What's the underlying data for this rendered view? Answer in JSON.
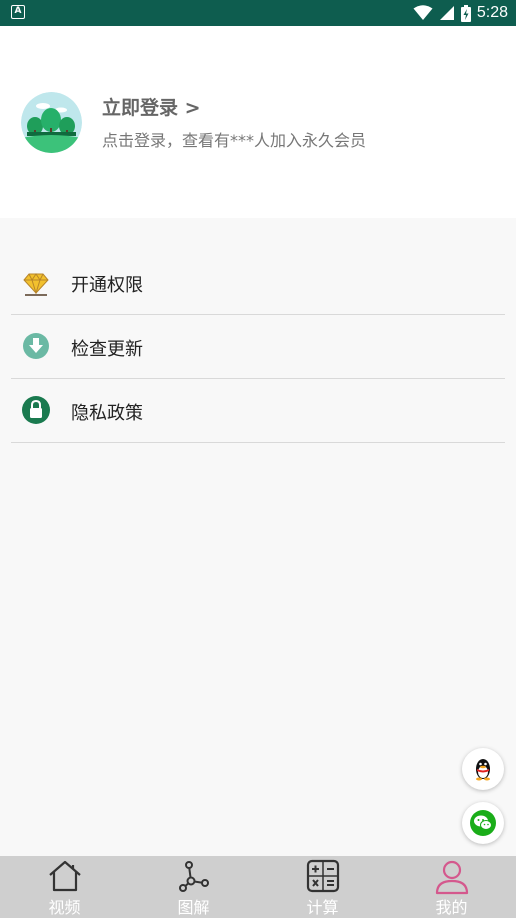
{
  "status_bar": {
    "app_badge": "A",
    "time": "5:28",
    "icons": [
      "wifi-icon",
      "signal-icon",
      "battery-charging-icon"
    ]
  },
  "profile": {
    "avatar_icon": "forest-avatar-icon",
    "login_title": "立即登录 >",
    "login_subtitle": "点击登录，查看有***人加入永久会员"
  },
  "menu": {
    "items": [
      {
        "label": "开通权限",
        "icon": "diamond-icon"
      },
      {
        "label": "检查更新",
        "icon": "download-circle-icon"
      },
      {
        "label": "隐私政策",
        "icon": "lock-circle-icon"
      }
    ]
  },
  "floating": {
    "qq_icon": "qq-penguin-icon",
    "wechat_icon": "wechat-icon"
  },
  "tabbar": {
    "active_color": "#d4588d",
    "inactive_color": "#333333",
    "tabs": [
      {
        "label": "视频",
        "icon": "home-icon",
        "active": false
      },
      {
        "label": "图解",
        "icon": "graph-nodes-icon",
        "active": false
      },
      {
        "label": "计算",
        "icon": "calculator-icon",
        "active": false
      },
      {
        "label": "我的",
        "icon": "user-icon",
        "active": true
      }
    ]
  },
  "colors": {
    "status_bar": "#0e5d4f",
    "accent_green": "#1a7a4f"
  }
}
